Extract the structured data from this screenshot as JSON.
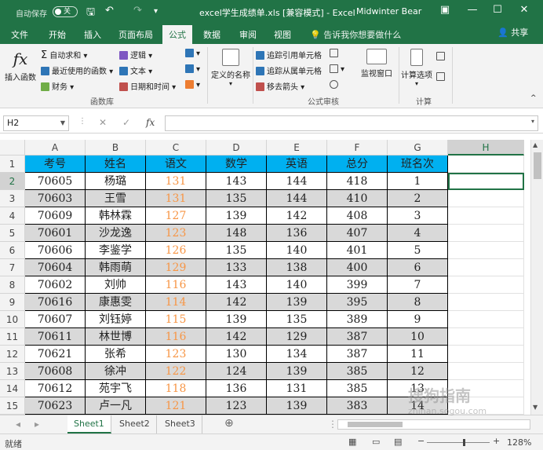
{
  "titlebar": {
    "autosave_label": "自动保存",
    "autosave_state": "关",
    "title": "excel学生成绩单.xls [兼容模式] - Excel",
    "user": "Midwinter Bear"
  },
  "tabs": [
    "文件",
    "开始",
    "插入",
    "页面布局",
    "公式",
    "数据",
    "审阅",
    "视图"
  ],
  "active_tab": "公式",
  "tell_me": "告诉我你想要做什么",
  "share": "共享",
  "ribbon": {
    "insert_function": "插入函数",
    "autosum": "自动求和",
    "recent": "最近使用的函数",
    "financial": "财务",
    "logical": "逻辑",
    "text": "文本",
    "datetime": "日期和时间",
    "library_group": "函数库",
    "define_name": "定义的名称",
    "trace_precedents": "追踪引用单元格",
    "trace_dependents": "追踪从属单元格",
    "remove_arrows": "移去箭头",
    "watch_window": "监视窗口",
    "audit_group": "公式审核",
    "calc_options": "计算选项",
    "calc_group": "计算"
  },
  "formula_bar": {
    "name_box": "H2",
    "fx": "fx",
    "formula": ""
  },
  "columns": [
    "A",
    "B",
    "C",
    "D",
    "E",
    "F",
    "G",
    "H"
  ],
  "header_row": [
    "考号",
    "姓名",
    "语文",
    "数学",
    "英语",
    "总分",
    "班名次"
  ],
  "rows": [
    [
      "70605",
      "杨璐",
      "131",
      "143",
      "144",
      "418",
      "1"
    ],
    [
      "70603",
      "王雪",
      "131",
      "135",
      "144",
      "410",
      "2"
    ],
    [
      "70609",
      "韩林霖",
      "127",
      "139",
      "142",
      "408",
      "3"
    ],
    [
      "70601",
      "沙龙逸",
      "123",
      "148",
      "136",
      "407",
      "4"
    ],
    [
      "70606",
      "李鉴学",
      "126",
      "135",
      "140",
      "401",
      "5"
    ],
    [
      "70604",
      "韩雨萌",
      "129",
      "133",
      "138",
      "400",
      "6"
    ],
    [
      "70602",
      "刘帅",
      "116",
      "143",
      "140",
      "399",
      "7"
    ],
    [
      "70616",
      "康惠雯",
      "114",
      "142",
      "139",
      "395",
      "8"
    ],
    [
      "70607",
      "刘钰婷",
      "115",
      "139",
      "135",
      "389",
      "9"
    ],
    [
      "70611",
      "林世博",
      "116",
      "142",
      "129",
      "387",
      "10"
    ],
    [
      "70621",
      "张希",
      "123",
      "130",
      "134",
      "387",
      "11"
    ],
    [
      "70608",
      "徐冲",
      "122",
      "124",
      "139",
      "385",
      "12"
    ],
    [
      "70612",
      "苑宇飞",
      "118",
      "136",
      "131",
      "385",
      "13"
    ],
    [
      "70623",
      "卢一凡",
      "121",
      "123",
      "139",
      "383",
      "14"
    ]
  ],
  "sheets": [
    "Sheet1",
    "Sheet2",
    "Sheet3"
  ],
  "status": {
    "ready": "就绪",
    "zoom": "128%"
  },
  "watermark": "搜狗指南",
  "watermark_url": "zhinan.sogou.com",
  "colors": {
    "accent": "#217346",
    "header_bg": "#00b0f0",
    "band_gray": "#d9d9d9",
    "chinese_score": "#f79646"
  }
}
